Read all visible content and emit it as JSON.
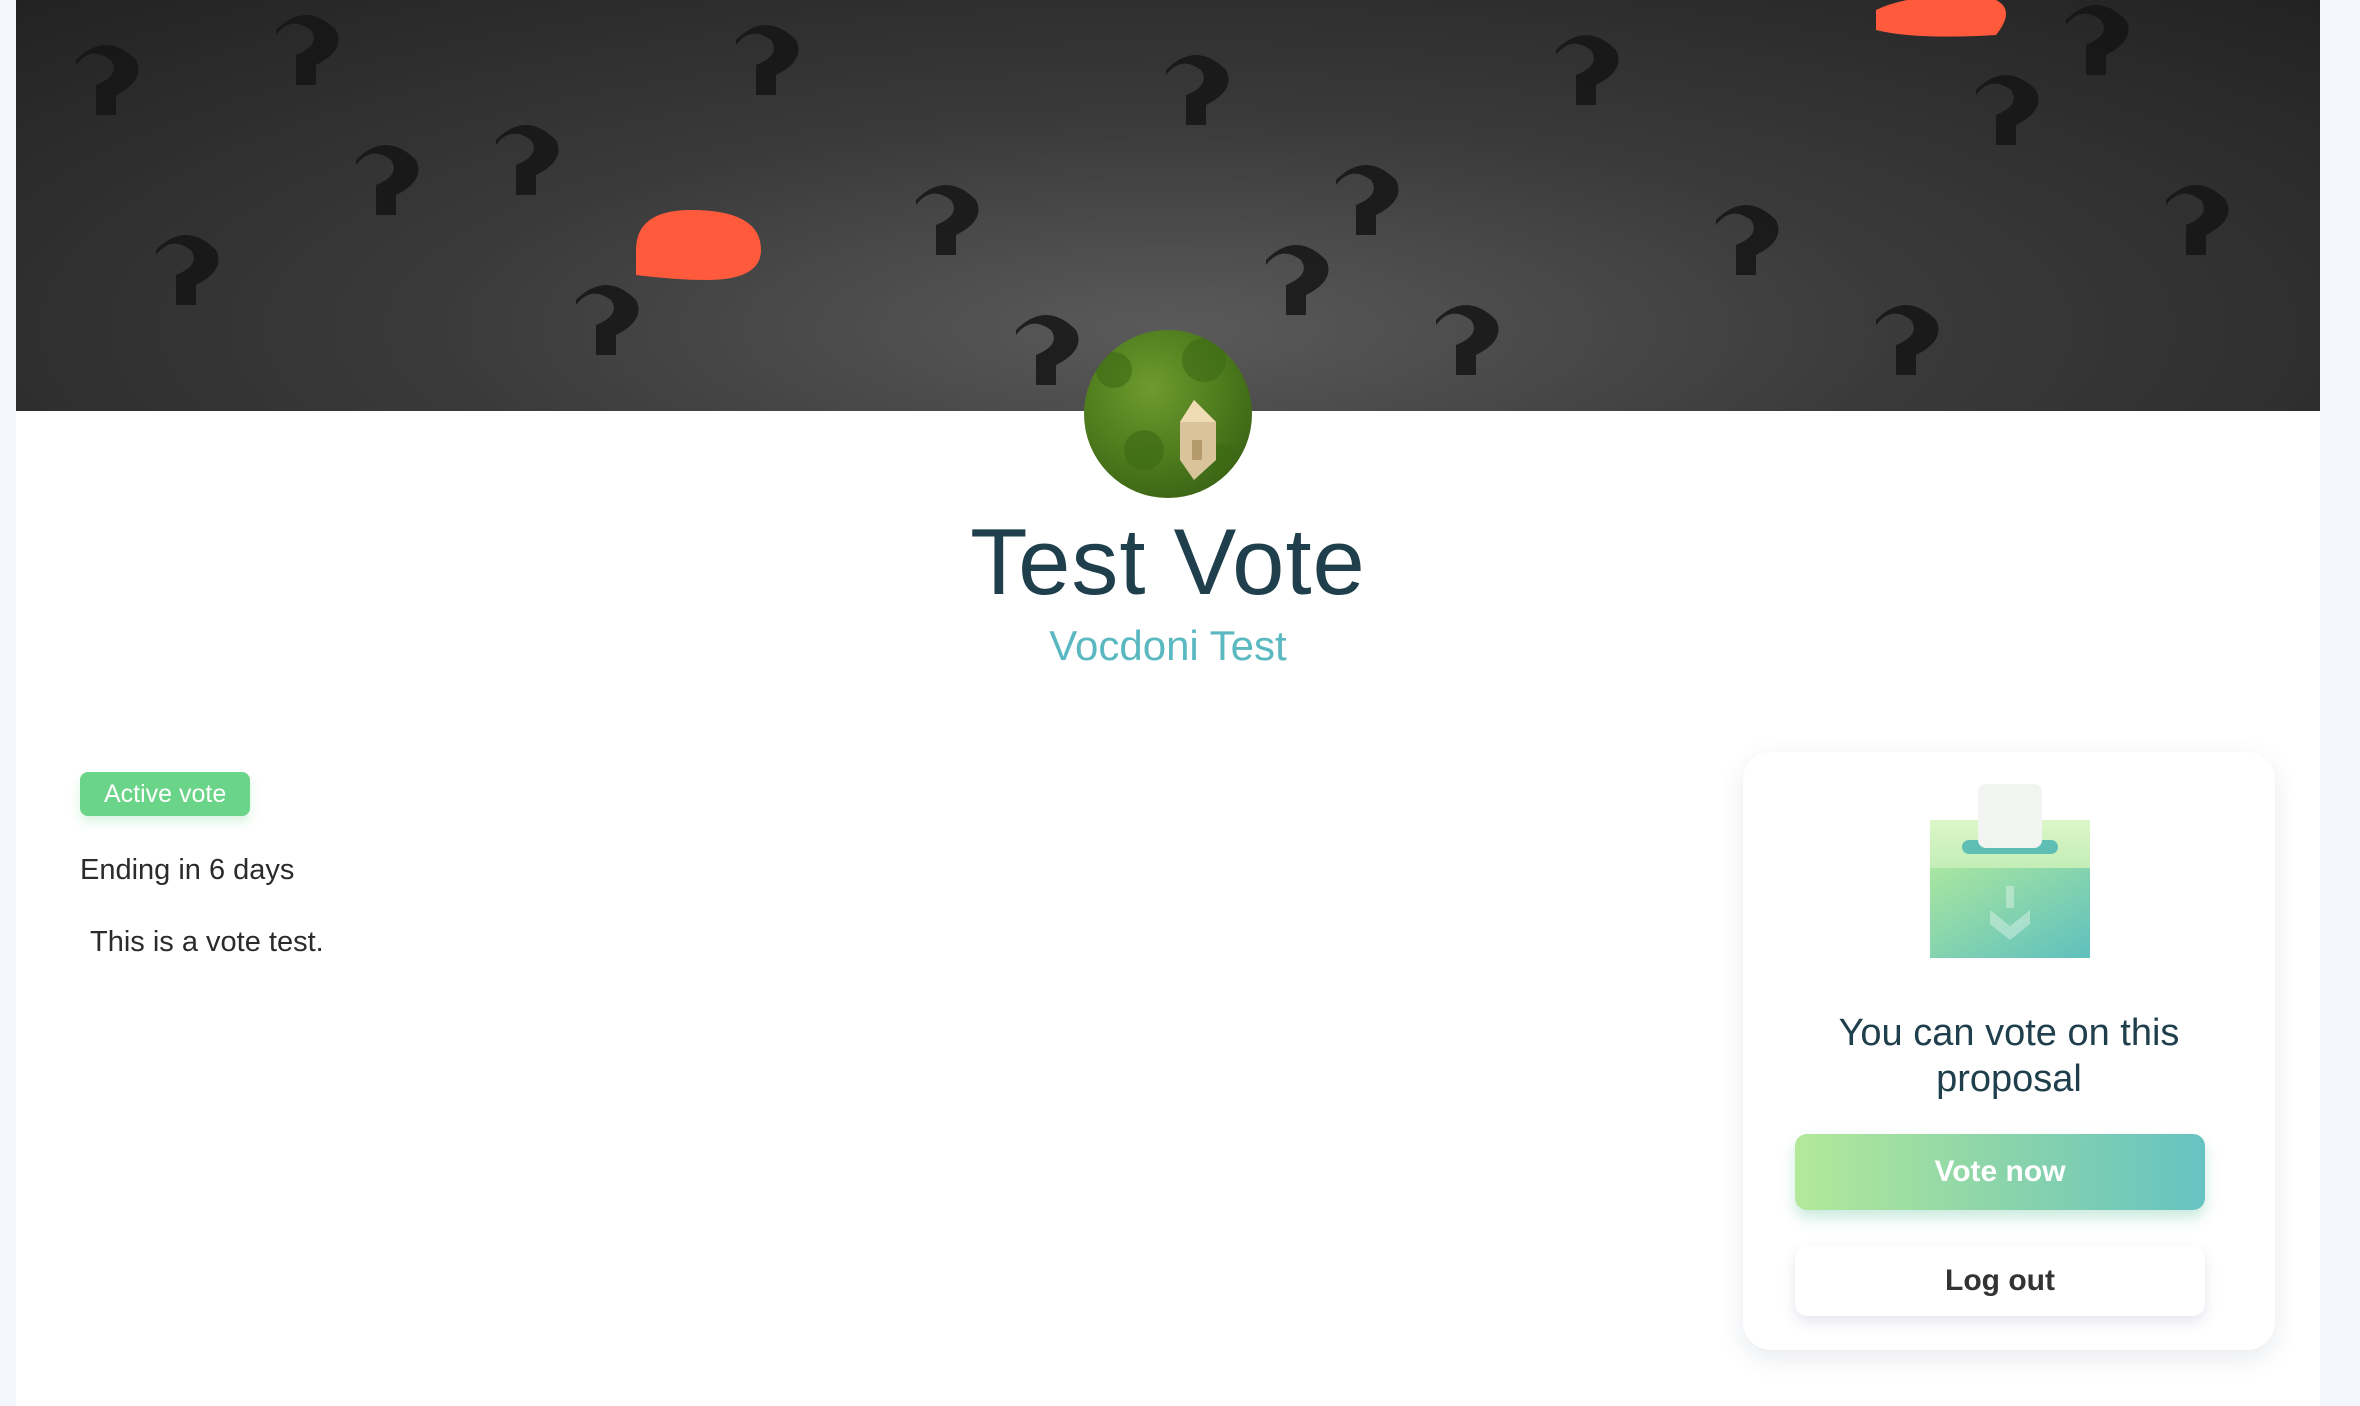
{
  "process": {
    "title": "Test Vote",
    "organization": "Vocdoni Test",
    "status_badge": "Active vote",
    "ending": "Ending in 6 days",
    "description": "This is a vote test."
  },
  "vote_card": {
    "message": "You can vote on this proposal",
    "vote_button": "Vote now",
    "logout_button": "Log out"
  },
  "images": {
    "banner_icon": "question-marks-banner-image",
    "avatar_icon": "house-on-grass-avatar-image",
    "ballot_icon": "ballot-box-icon"
  },
  "colors": {
    "title": "#1f3f4d",
    "subtitle": "#5ab8c0",
    "badge": "#6ad488",
    "button_gradient_start": "#b3e99a",
    "button_gradient_end": "#66c3c2"
  }
}
